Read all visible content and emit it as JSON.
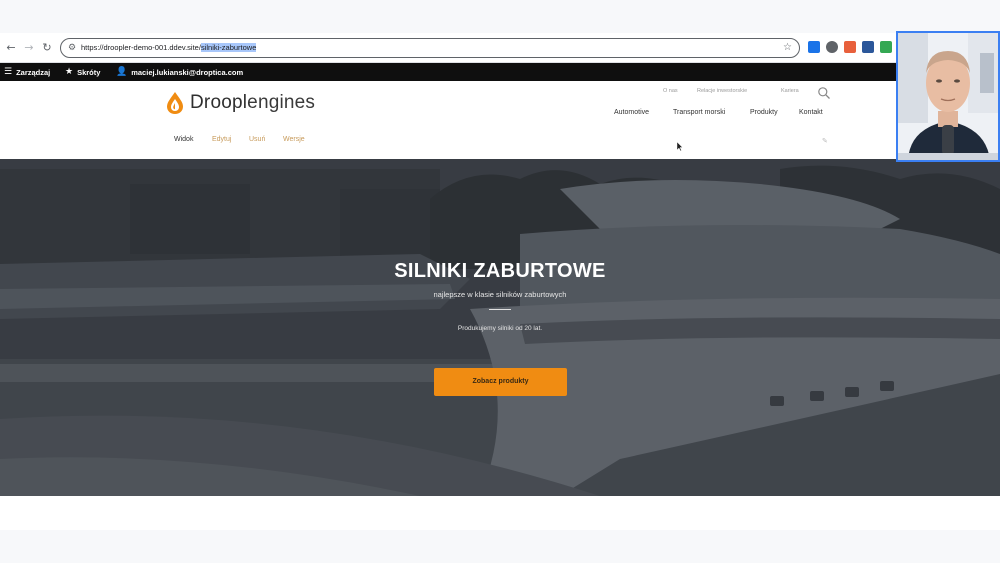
{
  "browser": {
    "url_base": "https://droopler-demo-001.ddev.site/",
    "url_selected": "silniki-zaburtowe"
  },
  "toolbar": {
    "manage_label": "Zarządzaj",
    "shortcuts_label": "Skróty",
    "user_label": "maciej.lukianski@droptica.com"
  },
  "site": {
    "logo_primary": "Droopl",
    "logo_secondary": "engines",
    "utility_links": [
      "O nas",
      "Relacje inwestorskie",
      "Kariera"
    ],
    "main_nav": [
      "Automotive",
      "Transport morski",
      "Produkty",
      "Kontakt"
    ],
    "tabs": [
      "Widok",
      "Edytuj",
      "Usuń",
      "Wersje"
    ]
  },
  "hero": {
    "title": "SILNIKI ZABURTOWE",
    "subtitle": "najlepsze w klasie silników zaburtowych",
    "note": "Produkujemy silniki od 20 lat.",
    "cta_label": "Zobacz produkty"
  },
  "colors": {
    "accent": "#f08c12",
    "toolbar_bg": "#0f0f0f",
    "hero_overlay": "#3e434b",
    "tab_inactive": "#c79a5a"
  }
}
